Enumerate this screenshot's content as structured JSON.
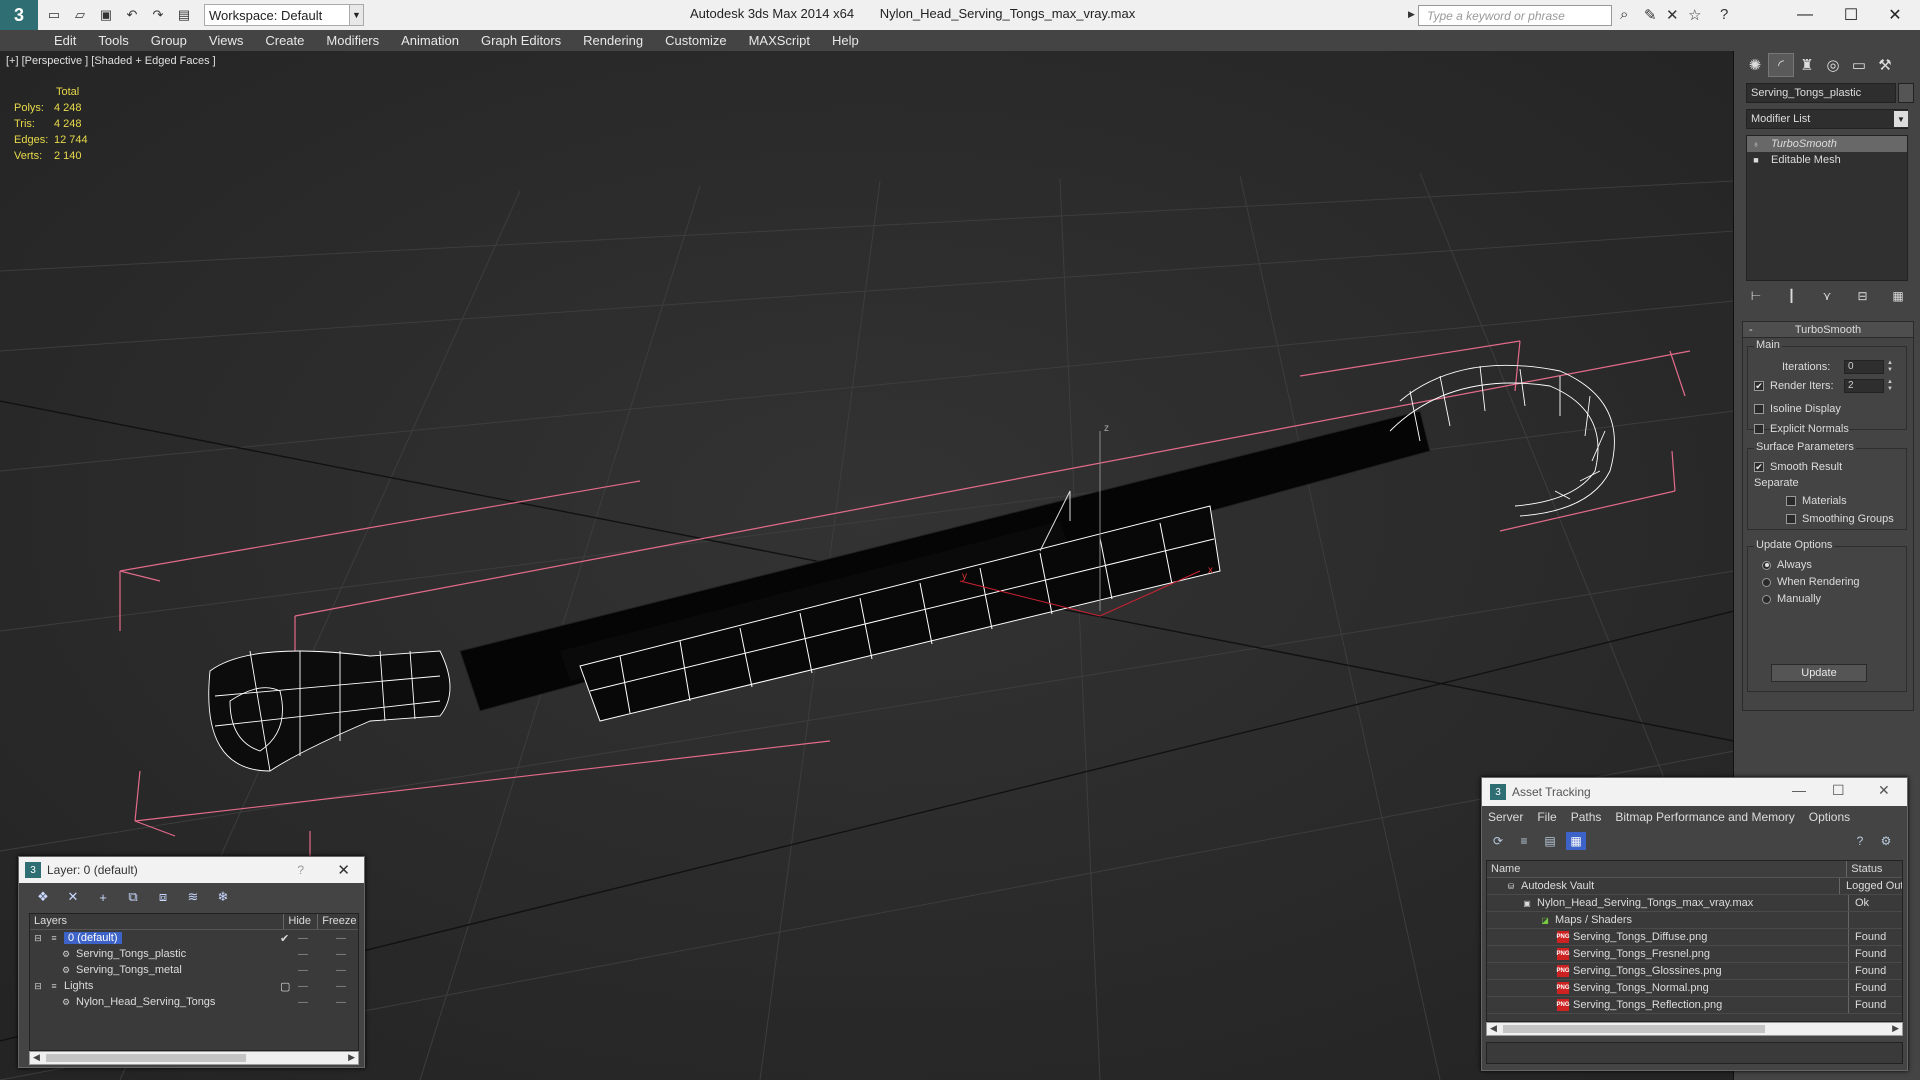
{
  "titlebar": {
    "workspace": "Workspace: Default",
    "app_name": "Autodesk 3ds Max  2014 x64",
    "file_name": "Nylon_Head_Serving_Tongs_max_vray.max",
    "search_placeholder": "Type a keyword or phrase"
  },
  "menu": [
    "Edit",
    "Tools",
    "Group",
    "Views",
    "Create",
    "Modifiers",
    "Animation",
    "Graph Editors",
    "Rendering",
    "Customize",
    "MAXScript",
    "Help"
  ],
  "viewport": {
    "label": "[+] [Perspective ] [Shaded + Edged Faces ]",
    "stats": {
      "header": "Total",
      "rows": [
        {
          "k": "Polys:",
          "v": "4 248"
        },
        {
          "k": "Tris:",
          "v": "4 248"
        },
        {
          "k": "Edges:",
          "v": "12 744"
        },
        {
          "k": "Verts:",
          "v": "2 140"
        }
      ]
    },
    "axis_labels": {
      "z": "z",
      "x": "x",
      "y": "y"
    }
  },
  "command_panel": {
    "object_name": "Serving_Tongs_plastic",
    "modifier_list": "Modifier List",
    "stack": [
      "TurboSmooth",
      "Editable Mesh"
    ],
    "rollout_title": "TurboSmooth",
    "main_label": "Main",
    "iterations_label": "Iterations:",
    "iterations_value": "0",
    "render_iters_label": "Render Iters:",
    "render_iters_value": "2",
    "isoline_display": "Isoline Display",
    "explicit_normals": "Explicit Normals",
    "surface_params": "Surface Parameters",
    "smooth_result": "Smooth Result",
    "separate": "Separate",
    "materials": "Materials",
    "smoothing_groups": "Smoothing Groups",
    "update_options": "Update Options",
    "always": "Always",
    "when_rendering": "When Rendering",
    "manually": "Manually",
    "update_button": "Update"
  },
  "layer_window": {
    "title": "Layer: 0 (default)",
    "help": "?",
    "columns": [
      "Layers",
      "Hide",
      "Freeze"
    ],
    "rows": [
      {
        "name": "0 (default)",
        "level": 0,
        "selected": true
      },
      {
        "name": "Serving_Tongs_plastic",
        "level": 1
      },
      {
        "name": "Serving_Tongs_metal",
        "level": 1
      },
      {
        "name": "Lights",
        "level": 0
      },
      {
        "name": "Nylon_Head_Serving_Tongs",
        "level": 1
      }
    ]
  },
  "asset_window": {
    "title": "Asset Tracking",
    "menu": [
      "Server",
      "File",
      "Paths",
      "Bitmap Performance and Memory",
      "Options"
    ],
    "columns": [
      "Name",
      "Status"
    ],
    "rows": [
      {
        "name": "Autodesk Vault",
        "status": "Logged Out",
        "level": 0
      },
      {
        "name": "Nylon_Head_Serving_Tongs_max_vray.max",
        "status": "Ok",
        "level": 1
      },
      {
        "name": "Maps / Shaders",
        "status": "",
        "level": 2
      },
      {
        "name": "Serving_Tongs_Diffuse.png",
        "status": "Found",
        "level": 3
      },
      {
        "name": "Serving_Tongs_Fresnel.png",
        "status": "Found",
        "level": 3
      },
      {
        "name": "Serving_Tongs_Glossines.png",
        "status": "Found",
        "level": 3
      },
      {
        "name": "Serving_Tongs_Normal.png",
        "status": "Found",
        "level": 3
      },
      {
        "name": "Serving_Tongs_Reflection.png",
        "status": "Found",
        "level": 3
      }
    ]
  },
  "colors": {
    "stats_text": "#e8d94a",
    "selection": "#3d63c8",
    "bounding_box": "#e36b8a",
    "wire": "#ffffff",
    "grid": "#3c3c3c"
  }
}
